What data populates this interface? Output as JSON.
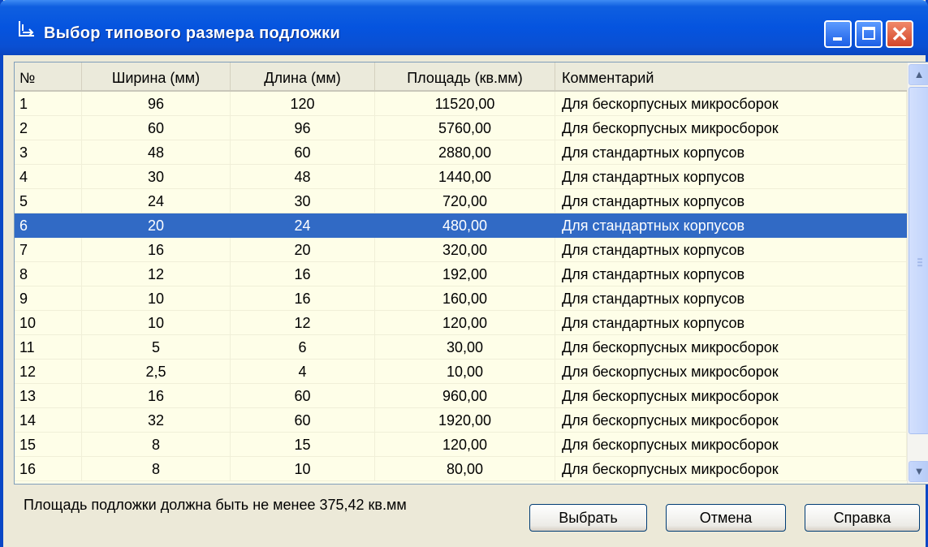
{
  "window": {
    "title": "Выбор типового размера подложки",
    "icon": "dimension-tool-icon"
  },
  "table": {
    "columns": [
      "№",
      "Ширина (мм)",
      "Длина (мм)",
      "Площадь (кв.мм)",
      "Комментарий"
    ],
    "selected_row_index": 5,
    "rows": [
      [
        "1",
        "96",
        "120",
        "11520,00",
        "Для бескорпусных микросборок"
      ],
      [
        "2",
        "60",
        "96",
        "5760,00",
        "Для бескорпусных микросборок"
      ],
      [
        "3",
        "48",
        "60",
        "2880,00",
        "Для стандартных корпусов"
      ],
      [
        "4",
        "30",
        "48",
        "1440,00",
        "Для стандартных корпусов"
      ],
      [
        "5",
        "24",
        "30",
        "720,00",
        "Для стандартных корпусов"
      ],
      [
        "6",
        "20",
        "24",
        "480,00",
        "Для стандартных корпусов"
      ],
      [
        "7",
        "16",
        "20",
        "320,00",
        "Для стандартных корпусов"
      ],
      [
        "8",
        "12",
        "16",
        "192,00",
        "Для стандартных корпусов"
      ],
      [
        "9",
        "10",
        "16",
        "160,00",
        "Для стандартных корпусов"
      ],
      [
        "10",
        "10",
        "12",
        "120,00",
        "Для стандартных корпусов"
      ],
      [
        "11",
        "5",
        "6",
        "30,00",
        "Для бескорпусных микросборок"
      ],
      [
        "12",
        "2,5",
        "4",
        "10,00",
        "Для бескорпусных микросборок"
      ],
      [
        "13",
        "16",
        "60",
        "960,00",
        "Для бескорпусных микросборок"
      ],
      [
        "14",
        "32",
        "60",
        "1920,00",
        "Для бескорпусных микросборок"
      ],
      [
        "15",
        "8",
        "15",
        "120,00",
        "Для бескорпусных микросборок"
      ],
      [
        "16",
        "8",
        "10",
        "80,00",
        "Для бескорпусных микросборок"
      ]
    ]
  },
  "footer": {
    "info": "Площадь подложки должна быть не менее 375,42 кв.мм",
    "buttons": {
      "select": "Выбрать",
      "cancel": "Отмена",
      "help": "Справка"
    }
  },
  "colors": {
    "titlebar": "#0554df",
    "selection": "#316ac5",
    "grid_background": "#fefee8",
    "window_background": "#ece9d8"
  }
}
